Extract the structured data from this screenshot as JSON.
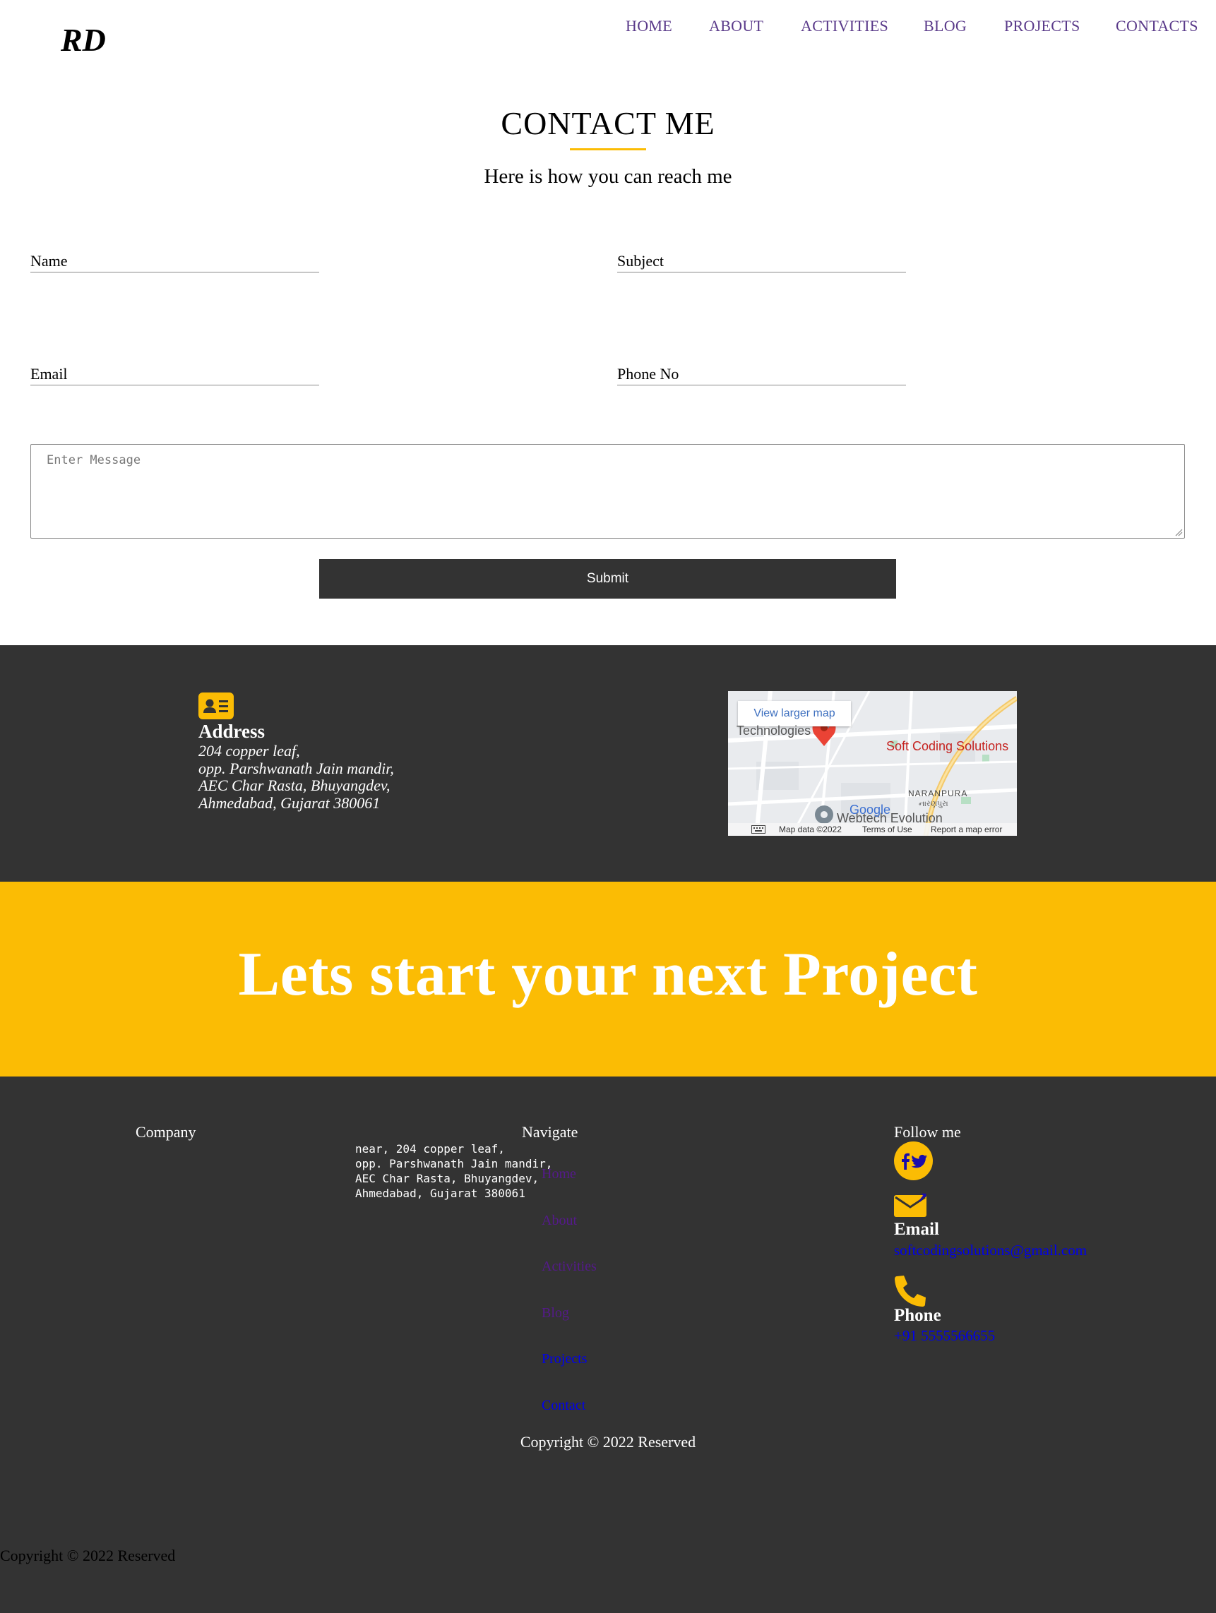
{
  "header": {
    "logo": "RD",
    "nav": [
      "HOME",
      "ABOUT",
      "ACTIVITIES",
      "BLOG",
      "PROJECTS",
      "CONTACTS"
    ]
  },
  "contact": {
    "title": "CONTACT ME",
    "subtitle": "Here is how you can reach me",
    "fields": {
      "name": "Name",
      "subject": "Subject",
      "email": "Email",
      "phone": "Phone No"
    },
    "message_placeholder": "Enter Message",
    "submit_label": "Submit"
  },
  "address_block": {
    "icon": "address-card-icon",
    "title": "Address",
    "lines": [
      "204 copper leaf,",
      "opp. Parshwanath Jain mandir,",
      "AEC Char Rasta, Bhuyangdev,",
      "Ahmedabad, Gujarat 380061"
    ]
  },
  "map": {
    "view_larger": "View larger map",
    "place_name": "Soft Coding Solutions",
    "label_tech": "Technologies",
    "label_area": "NARANPURA",
    "label_local": "નારણપુરા",
    "label_poi": "Webtech Evolution",
    "google": "Google",
    "footer_links": [
      "Map data ©2022",
      "Terms of Use",
      "Report a map error"
    ]
  },
  "banner": {
    "text": "Lets start your next Project"
  },
  "footer": {
    "company_heading": "Company",
    "company_address": "near, 204 copper leaf,\nopp. Parshwanath Jain mandir,\nAEC Char Rasta, Bhuyangdev,\nAhmedabad, Gujarat 380061",
    "navigate_heading": "Navigate",
    "nav_links": [
      {
        "label": "Home",
        "color": "#551a8b"
      },
      {
        "label": "About",
        "color": "#551a8b"
      },
      {
        "label": "Activities",
        "color": "#551a8b"
      },
      {
        "label": "Blog",
        "color": "#551a8b"
      },
      {
        "label": "Projects",
        "color": "#0000ee"
      },
      {
        "label": "Contact",
        "color": "#0000ee"
      }
    ],
    "follow_heading": "Follow me",
    "social_icons": [
      "facebook-icon",
      "twitter-icon"
    ],
    "email_label": "Email",
    "email_value": "softcodingsolutions@gmail.com",
    "phone_label": "Phone",
    "phone_value": "+91 5555566655",
    "copyright": "Copyright © 2022 Reserved"
  },
  "copyright_bottom": "Copyright © 2022 Reserved",
  "colors": {
    "accent": "#fbbc04",
    "dark": "#333333",
    "nav": "#5a3a8a"
  }
}
